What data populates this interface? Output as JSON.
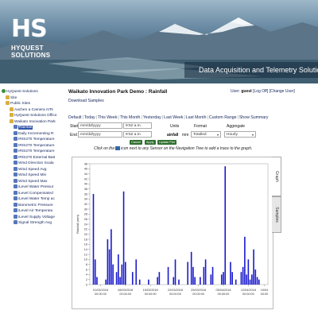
{
  "banner": {
    "logo_text": "HS",
    "brand_line1": "HYQUEST",
    "brand_line2": "SOLUTIONS",
    "tagline": "Data Acquisition and Telemetry Solutions"
  },
  "sidebar": {
    "items": [
      {
        "label": "HyQuest Solutions",
        "icon": "globe-icon",
        "indent": 0
      },
      {
        "label": "Site",
        "icon": "folder-icon",
        "indent": 1
      },
      {
        "label": "Public Sites",
        "icon": "folder-icon",
        "indent": 1
      },
      {
        "label": "Aachen a Camera mTs",
        "icon": "folder-icon",
        "indent": 2
      },
      {
        "label": "HyQuest Solutions Office",
        "icon": "folder-icon",
        "indent": 2
      },
      {
        "label": "Waikato Innovation Park",
        "icon": "folder-icon",
        "indent": 2
      },
      {
        "label": "Rainfall",
        "icon": "sensor-icon",
        "indent": 3,
        "selected": true
      },
      {
        "label": "Daily Incrementing R",
        "icon": "sensor-icon",
        "indent": 3
      },
      {
        "label": "IRIS270 Temperature",
        "icon": "sensor-icon",
        "indent": 3
      },
      {
        "label": "IRIS270 Temperature",
        "icon": "sensor-icon",
        "indent": 3
      },
      {
        "label": "IRIS270 Temperature",
        "icon": "sensor-icon",
        "indent": 3
      },
      {
        "label": "IRIS270 External Batt",
        "icon": "sensor-icon",
        "indent": 3
      },
      {
        "label": "Wind Direction Scala",
        "icon": "sensor-icon",
        "indent": 3
      },
      {
        "label": "Wind Speed Avg",
        "icon": "sensor-icon",
        "indent": 3
      },
      {
        "label": "Wind Speed Min",
        "icon": "sensor-icon",
        "indent": 3
      },
      {
        "label": "Wind Speed Max",
        "icon": "sensor-icon",
        "indent": 3
      },
      {
        "label": "iLevel Water Pressur",
        "icon": "sensor-icon",
        "indent": 3
      },
      {
        "label": "iLevel Compensated",
        "icon": "sensor-icon",
        "indent": 3
      },
      {
        "label": "iLevel Water Temp ac",
        "icon": "sensor-icon",
        "indent": 3
      },
      {
        "label": "Barometric Pressure",
        "icon": "sensor-icon",
        "indent": 3
      },
      {
        "label": "iLevel Air Temperatu",
        "icon": "sensor-icon",
        "indent": 3
      },
      {
        "label": "iLevel Supply Voltage",
        "icon": "sensor-icon",
        "indent": 3
      },
      {
        "label": "Signal Strength Avg",
        "icon": "sensor-icon",
        "indent": 3
      }
    ]
  },
  "header": {
    "title": "Waikato Innovation Park Demo : Rainfall",
    "user_prefix": "User:",
    "user_name": "guest",
    "logoff": "[Log Off]",
    "change_user": "[Change User]",
    "download": "Download Samples"
  },
  "periods": [
    "Default",
    "Today",
    "This Week",
    "This Month",
    "Yesterday",
    "Last Week",
    "Last Month",
    "Custom Range",
    "Show Summary"
  ],
  "form": {
    "start_label": "Start",
    "end_label": "End",
    "date_placeholder": "mm/dd/yyyy",
    "start_time": "9:52 a.m.",
    "end_time": "9:52 a.m.",
    "units_label": "Units",
    "format_label": "Format",
    "aggregate_label": "Aggregate",
    "rainfall_label": "ainfall",
    "unit_value": "mm",
    "format_value": "Totalled",
    "aggregate_value": "Hourly",
    "cancel": "Cancel",
    "apply": "Apply",
    "update_plot": "Update Plot"
  },
  "hint": {
    "before": "Click on the",
    "after": "icon next to any Sensor on the Navigation Tree to add a trace to the graph."
  },
  "tabs": {
    "graph": "Graph",
    "samples": "Samples"
  },
  "colors": {
    "bar": "#1a1acc",
    "link": "#1a2a60"
  },
  "chart_data": {
    "type": "bar",
    "ylabel": "Rainfall (mm)",
    "ylim": [
      0,
      48
    ],
    "yticks": [
      0,
      2,
      4,
      6,
      8,
      10,
      12,
      14,
      16,
      18,
      20,
      22,
      24,
      26,
      28,
      30,
      32,
      34,
      36,
      38,
      40,
      42,
      44,
      46,
      48
    ],
    "xlim": [
      0,
      100
    ],
    "xticks": [
      {
        "x": 6,
        "line1": "01/03/2018",
        "line2": "00:00:00"
      },
      {
        "x": 20,
        "line1": "08/03/2018",
        "line2": "00:00:00"
      },
      {
        "x": 34,
        "line1": "15/03/2018",
        "line2": "00:00:00"
      },
      {
        "x": 48,
        "line1": "22/03/2018",
        "line2": "00:00:00"
      },
      {
        "x": 61,
        "line1": "29/03/2018",
        "line2": "00:00:00"
      },
      {
        "x": 75,
        "line1": "05/04/2018",
        "line2": "00:00:00"
      },
      {
        "x": 89,
        "line1": "12/04/2018",
        "line2": "00:00:00"
      },
      {
        "x": 98,
        "line1": "19/04",
        "line2": "00:00"
      }
    ],
    "x": [
      2,
      3,
      4,
      9,
      10,
      11,
      12,
      13,
      15,
      16,
      17,
      18,
      19,
      20,
      24,
      26,
      28,
      33,
      38,
      39,
      44,
      47,
      48,
      50,
      55,
      57,
      58,
      59,
      62,
      64,
      65,
      68,
      69,
      74,
      75,
      76,
      79,
      80,
      82,
      85,
      86,
      87,
      88,
      89,
      90,
      91,
      92,
      93,
      94,
      95
    ],
    "values": [
      36,
      10,
      3,
      2,
      18,
      14,
      22,
      8,
      5,
      12,
      3,
      8,
      37,
      9,
      5,
      10,
      2,
      2,
      3,
      5,
      7,
      3,
      10,
      2,
      9,
      13,
      7,
      3,
      3,
      7,
      10,
      4,
      7,
      4,
      5,
      47,
      9,
      5,
      2,
      5,
      7,
      19,
      4,
      10,
      2,
      4,
      14,
      6,
      3,
      2
    ]
  }
}
